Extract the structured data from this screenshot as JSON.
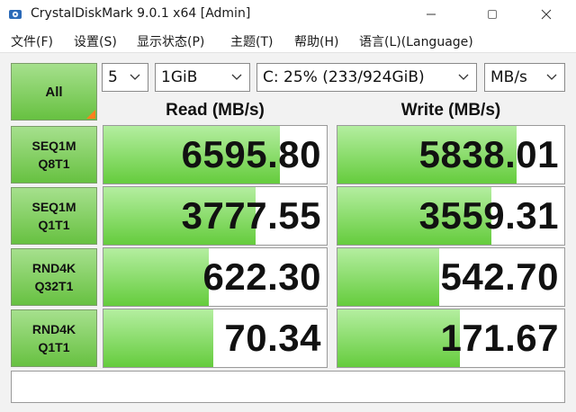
{
  "window": {
    "title": "CrystalDiskMark 9.0.1 x64 [Admin]",
    "controls": {
      "minimize": "—",
      "maximize": "☐",
      "close": "✕"
    }
  },
  "menu": [
    "文件(F)",
    "设置(S)",
    "显示状态(P)",
    "主题(T)",
    "帮助(H)",
    "语言(L)(Language)"
  ],
  "controls": {
    "all_label": "All",
    "count": "5",
    "size": "1GiB",
    "drive": "C: 25% (233/924GiB)",
    "unit": "MB/s"
  },
  "headers": {
    "read": "Read (MB/s)",
    "write": "Write (MB/s)"
  },
  "tests": [
    {
      "line1": "SEQ1M",
      "line2": "Q8T1",
      "read": "6595.80",
      "write": "5838.01",
      "read_level": 0.79,
      "write_level": 0.79
    },
    {
      "line1": "SEQ1M",
      "line2": "Q1T1",
      "read": "3777.55",
      "write": "3559.31",
      "read_level": 0.68,
      "write_level": 0.68
    },
    {
      "line1": "RND4K",
      "line2": "Q32T1",
      "read": "622.30",
      "write": "542.70",
      "read_level": 0.47,
      "write_level": 0.45
    },
    {
      "line1": "RND4K",
      "line2": "Q1T1",
      "read": "70.34",
      "write": "171.67",
      "read_level": 0.49,
      "write_level": 0.54
    }
  ],
  "status": "",
  "colors": {
    "accent_green": "#67c141",
    "corner_orange": "#ff7f1f"
  },
  "icons": {
    "app": "crystaldiskmark-icon",
    "dropdown": "chevron-down-icon"
  }
}
